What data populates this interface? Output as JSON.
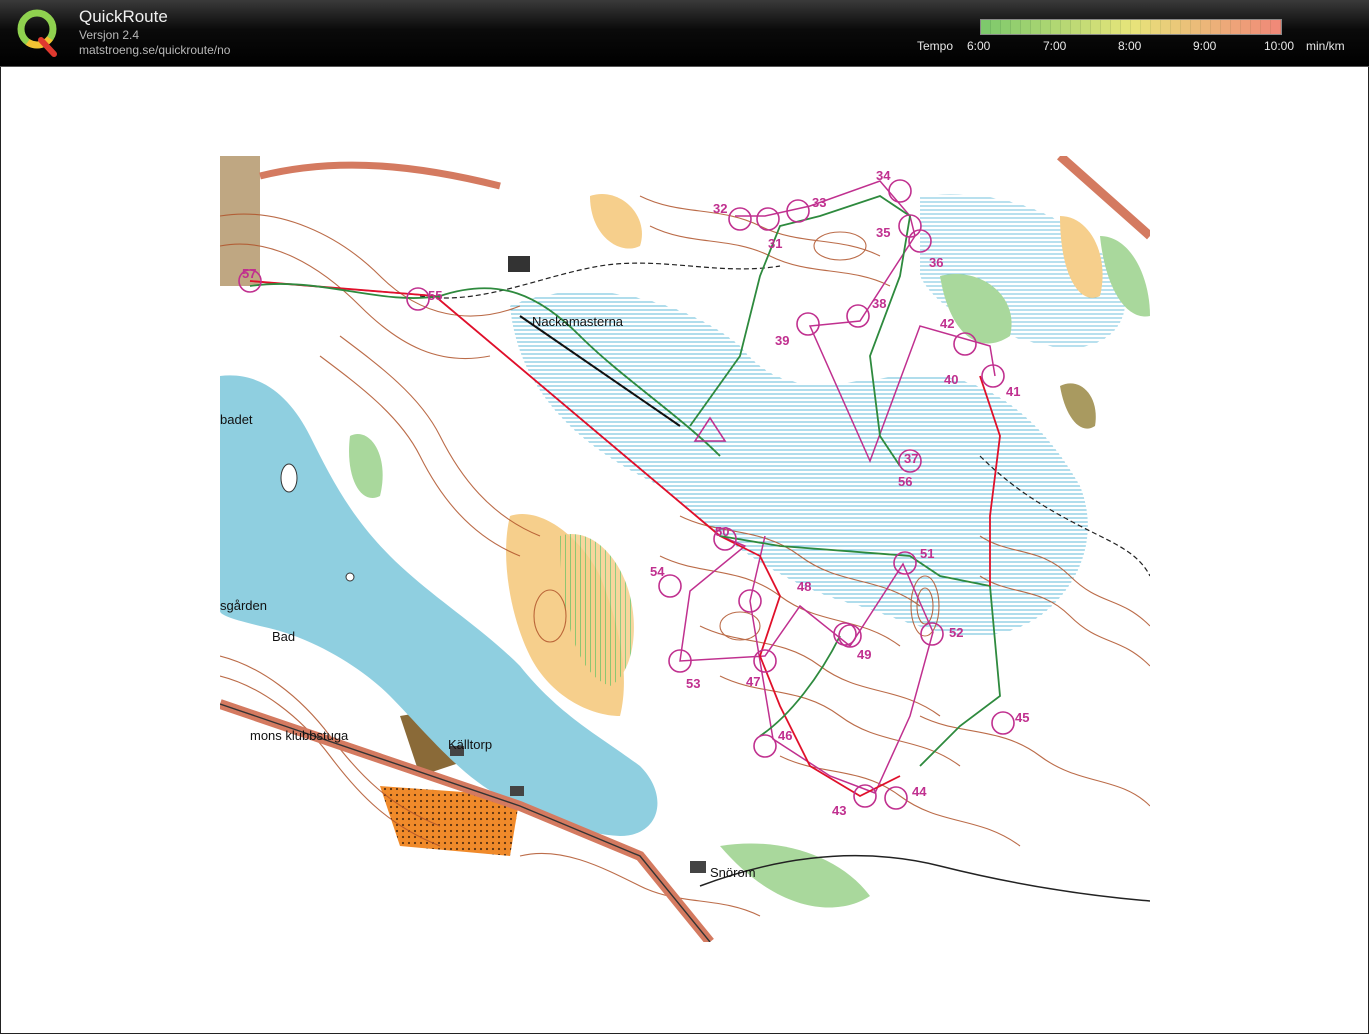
{
  "app": {
    "name": "QuickRoute",
    "version": "Versjon 2.4",
    "url": "matstroeng.se/quickroute/no"
  },
  "legend": {
    "label": "Tempo",
    "ticks": [
      "6:00",
      "7:00",
      "8:00",
      "9:00",
      "10:00"
    ],
    "unit": "min/km",
    "colors": {
      "fast": "#7ec96c",
      "mid": "#e7e57a",
      "slow": "#f08a78"
    }
  },
  "map": {
    "labels": {
      "nackamasterna": "Nackamasterna",
      "badet": "badet",
      "asgarden": "sgården",
      "bad": "Bad",
      "klubbstuga": "mons klubbstuga",
      "kalltorp": "Källtorp",
      "snorom": "Snörom"
    },
    "controls": [
      "31",
      "32",
      "33",
      "34",
      "35",
      "36",
      "37",
      "38",
      "39",
      "40",
      "41",
      "42",
      "43",
      "44",
      "45",
      "46",
      "47",
      "48",
      "49",
      "50",
      "51",
      "52",
      "53",
      "54",
      "55",
      "56",
      "57"
    ],
    "colors": {
      "water": "#8fcfe0",
      "forest": "#ffffff",
      "rough": "#f6cf8c",
      "green": "#a9d89c",
      "contour": "#b0532a",
      "course": "#c0308f",
      "route": "#e0102a",
      "track": "#2e8a3e"
    }
  }
}
